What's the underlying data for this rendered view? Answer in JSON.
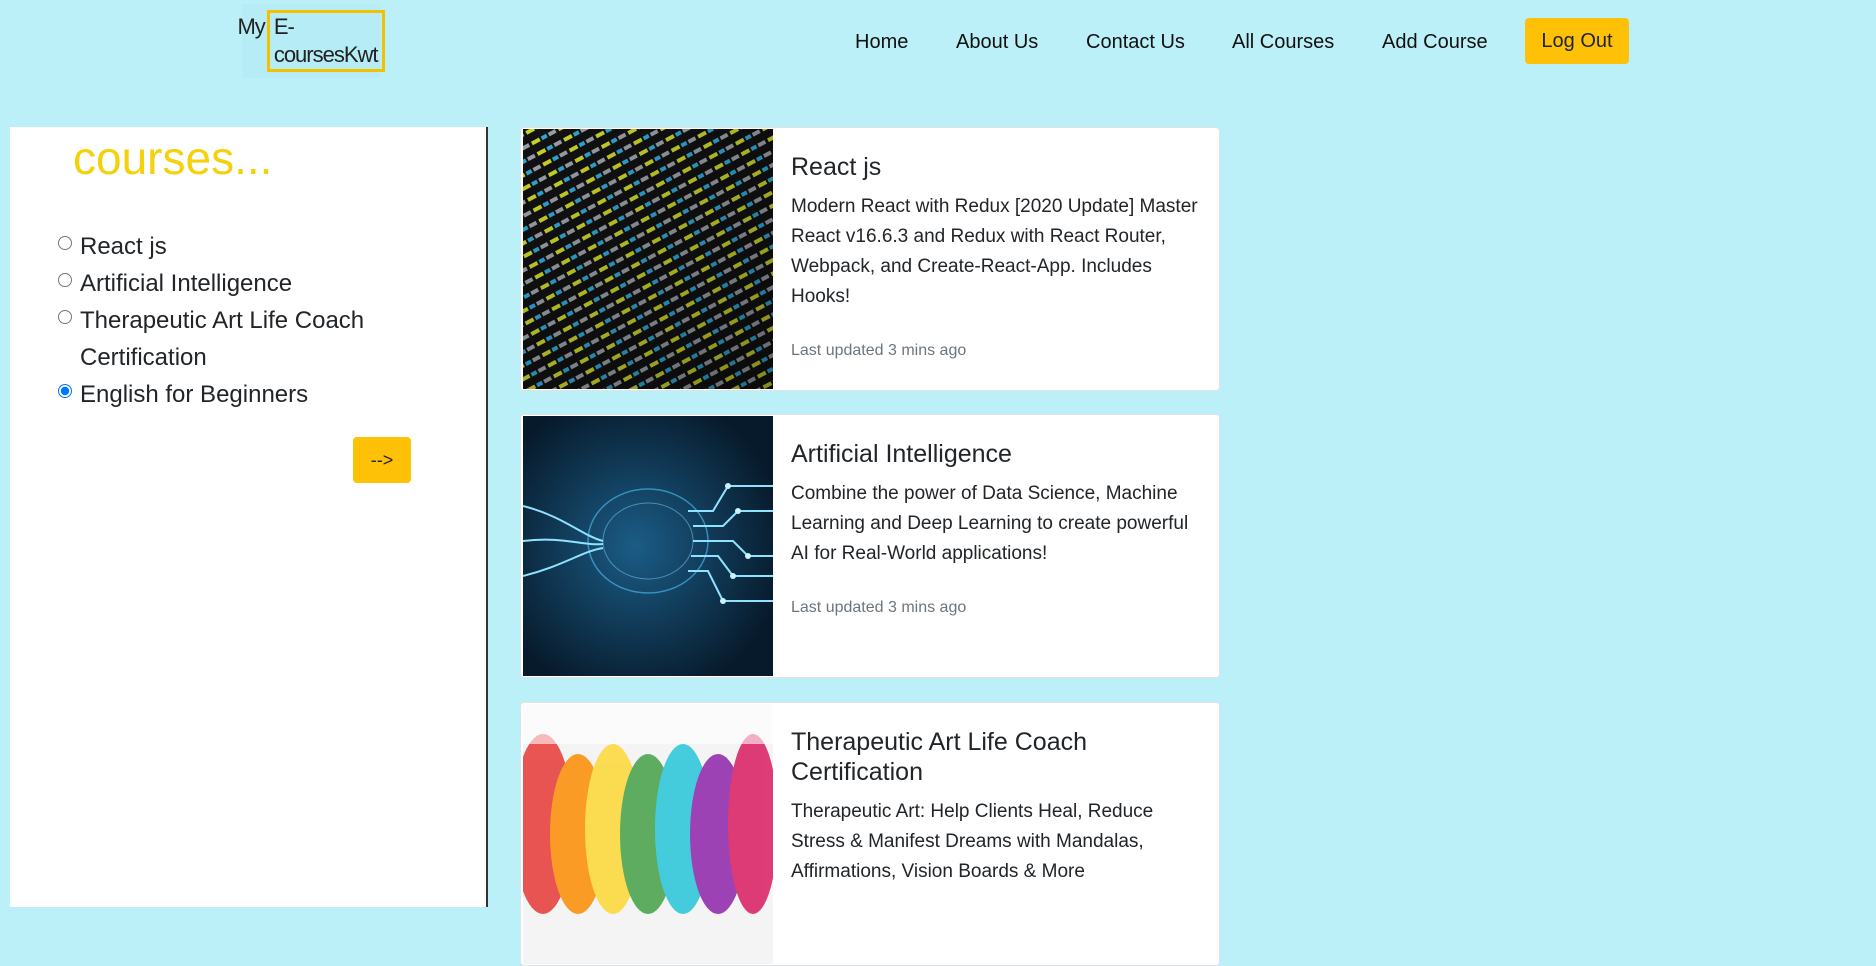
{
  "header": {
    "logo_prefix": "My",
    "logo_brand": "E-coursesKwt",
    "nav": [
      "Home",
      "About Us",
      "Contact Us",
      "All Courses",
      "Add Course"
    ],
    "logout": "Log Out",
    "accent_color": "#ffc107"
  },
  "sidebar": {
    "title": "courses...",
    "options": [
      {
        "label": "React js",
        "checked": false
      },
      {
        "label": "Artificial Intelligence",
        "checked": false
      },
      {
        "label": "Therapeutic Art Life Coach Certification",
        "checked": false
      },
      {
        "label": "English for Beginners",
        "checked": true
      }
    ],
    "next_button": "-->"
  },
  "courses": [
    {
      "title": "React js",
      "description": "Modern React with Redux [2020 Update] Master React v16.6.3 and Redux with React Router, Webpack, and Create-React-App. Includes Hooks!",
      "updated": "Last updated 3 mins ago",
      "image": "code-screen-image"
    },
    {
      "title": "Artificial Intelligence",
      "description": "Combine the power of Data Science, Machine Learning and Deep Learning to create powerful AI for Real-World applications!",
      "updated": "Last updated 3 mins ago",
      "image": "circuit-brain-image"
    },
    {
      "title": "Therapeutic Art Life Coach Certification",
      "description": "Therapeutic Art: Help Clients Heal, Reduce Stress & Manifest Dreams with Mandalas, Affirmations, Vision Boards & More",
      "updated": "",
      "image": "rainbow-smoke-image"
    }
  ]
}
